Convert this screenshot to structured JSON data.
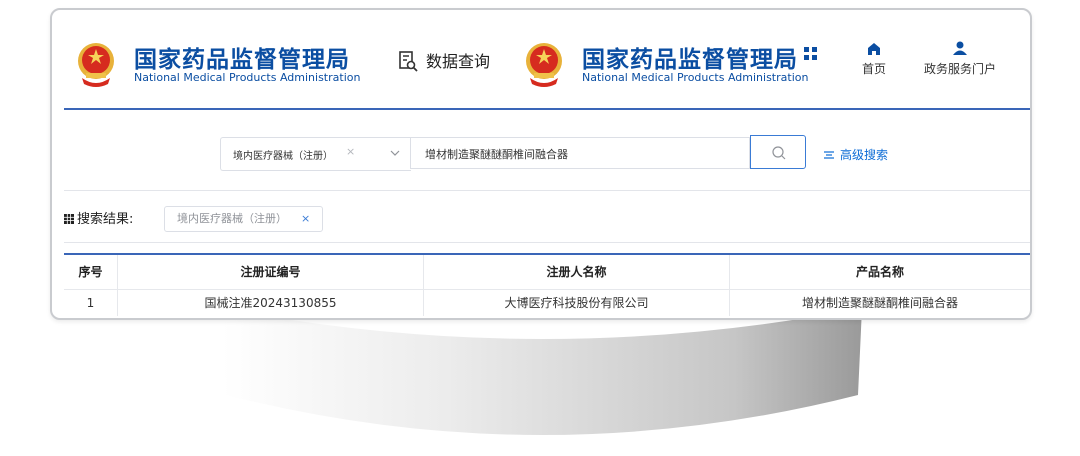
{
  "header": {
    "left_brand_cn": "国家药品监督管理局",
    "left_brand_en": "National Medical Products Administration",
    "section_title": "数据查询",
    "right_brand_cn": "国家药品监督管理局",
    "right_brand_en": "National Medical Products Administration",
    "nav": [
      {
        "label": "首页",
        "icon": "home-icon"
      },
      {
        "label": "政务服务门户",
        "icon": "user-icon"
      }
    ]
  },
  "search": {
    "category_selected": "境内医疗器械（注册）",
    "keyword_value": "增材制造聚醚醚酮椎间融合器",
    "advanced_label": "高级搜索"
  },
  "results": {
    "label": "搜索结果:",
    "filter_tag": "境内医疗器械（注册）"
  },
  "table": {
    "headers": [
      "序号",
      "注册证编号",
      "注册人名称",
      "产品名称"
    ],
    "rows": [
      [
        "1",
        "国械注准20243130855",
        "大博医疗科技股份有限公司",
        "增材制造聚醚醚酮椎间融合器"
      ]
    ]
  },
  "colors": {
    "brand_blue": "#0b4ea2",
    "accent_blue": "#3a66b8",
    "link_blue": "#0b6bd6"
  }
}
